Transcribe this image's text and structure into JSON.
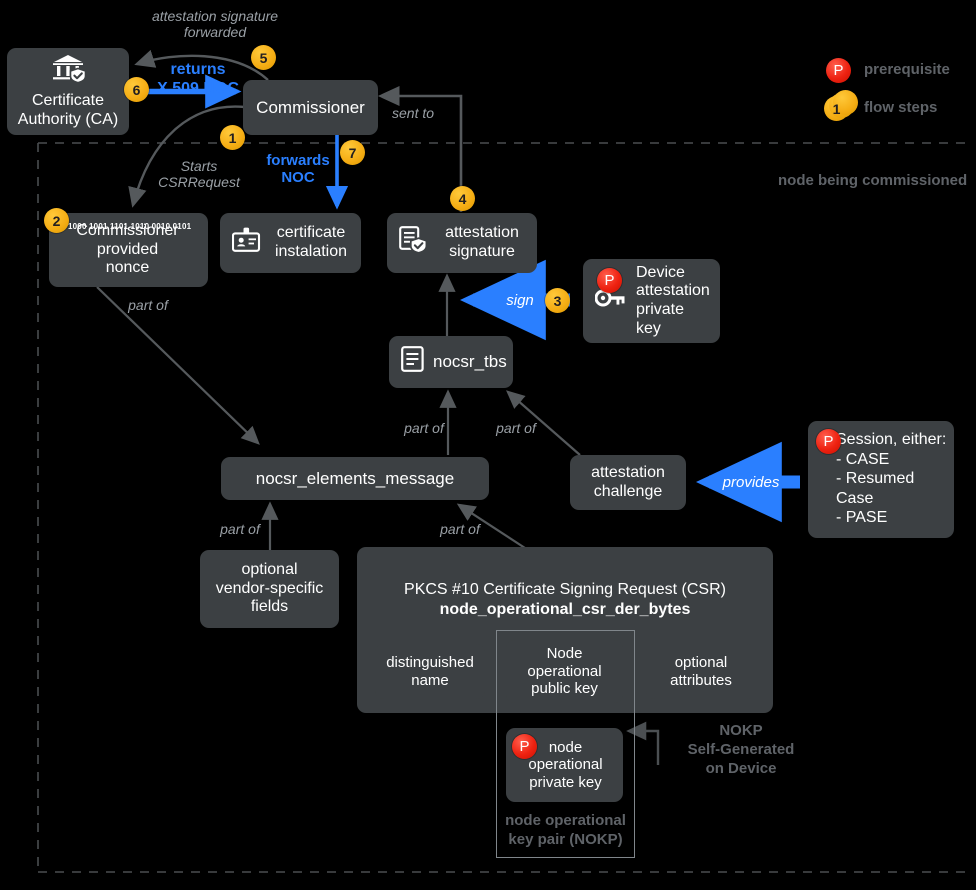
{
  "diagram": {
    "region_label": "node being commissioned"
  },
  "legend": {
    "prerequisite": {
      "badge": "P",
      "label": "prerequisite"
    },
    "flow_steps": {
      "badge": "1",
      "label": "flow steps"
    }
  },
  "nodes": {
    "certificate_authority": {
      "label": "Certificate\nAuthority (CA)",
      "icon": "bank-verified-icon"
    },
    "commissioner": {
      "label": "Commissioner"
    },
    "commissioner_nonce": {
      "label": "Commissioner\nprovided\nnonce",
      "badge": "2",
      "bits": "1000\n1001\n1101\n1010\n0010\n0101"
    },
    "certificate_installation": {
      "label": "certificate\ninstalation",
      "icon": "id-badge-icon"
    },
    "attestation_signature": {
      "label": "attestation\nsignature",
      "badge": "4",
      "icon": "document-verified-icon"
    },
    "device_attestation_private_key": {
      "label": "Device\nattestation\nprivate key",
      "badge": "P",
      "icon": "key-icon"
    },
    "nocsr_tbs": {
      "label": "nocsr_tbs",
      "icon": "document-lines-icon"
    },
    "nocsr_elements_message": {
      "label": "nocsr_elements_message"
    },
    "attestation_challenge": {
      "label": "attestation\nchallenge"
    },
    "session": {
      "label": "Session, either:\n- CASE\n- Resumed Case\n- PASE",
      "badge": "P"
    },
    "optional_vendor_fields": {
      "label": "optional\nvendor-specific\nfields"
    },
    "csr": {
      "title_line1": "PKCS #10 Certificate Signing Request (CSR)",
      "title_line2": "node_operational_csr_der_bytes"
    },
    "distinguished_name": {
      "label": "distinguished\nname"
    },
    "node_operational_public_key": {
      "label": "Node\noperational\npublic key"
    },
    "optional_attributes": {
      "label": "optional\nattributes"
    },
    "node_operational_private_key": {
      "label": "node\noperational\nprivate key",
      "badge": "P"
    },
    "nokp_group_label": {
      "label": "node operational\nkey pair (NOKP)"
    },
    "nokp_self_generated": {
      "label": "NOKP\nSelf-Generated\non Device"
    }
  },
  "edges": {
    "attestation_forwarded": {
      "label": "attestation signature\nforwarded",
      "badge": "5"
    },
    "returns_noc": {
      "label": "returns\nX.509 NOC",
      "badge": "6"
    },
    "starts_csrrequest": {
      "label": "Starts\nCSRRequest",
      "badge": "1"
    },
    "forwards_noc": {
      "label": "forwards\nNOC",
      "badge": "7"
    },
    "sent_to": {
      "label": "sent to"
    },
    "sign": {
      "label": "sign",
      "badge": "3"
    },
    "provides": {
      "label": "provides"
    },
    "part_of_nonce": {
      "label": "part of"
    },
    "part_of_vendor": {
      "label": "part of"
    },
    "part_of_csr": {
      "label": "part of"
    },
    "part_of_elements": {
      "label": "part of"
    },
    "part_of_challenge": {
      "label": "part of"
    }
  },
  "colors": {
    "background": "#000000",
    "node_fill": "#3c4043",
    "accent_blue": "#2a7fff",
    "badge_yellow": "#f5ad14",
    "badge_red": "#ee2211",
    "grey_text": "#9aa0a6",
    "region_border": "#5f6368"
  }
}
